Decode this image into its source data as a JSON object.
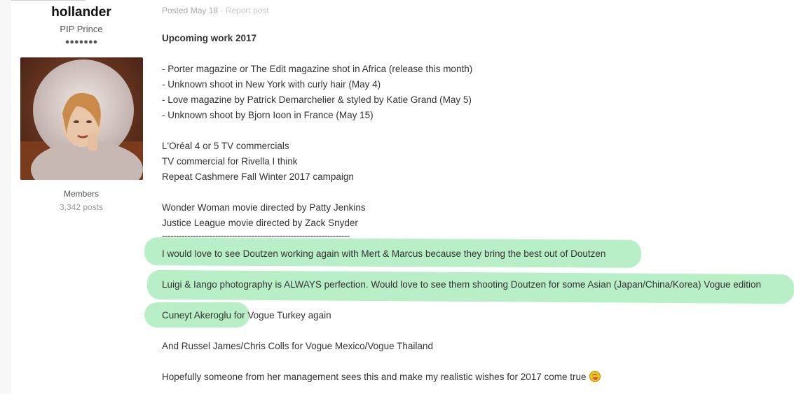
{
  "author": {
    "username": "hollander",
    "rank": "PIP Prince",
    "rank_pips": "●●●●●●●",
    "group": "Members",
    "post_count": "3,342 posts"
  },
  "post": {
    "posted": "Posted May 18",
    "separator": " · ",
    "report": "Report post",
    "title": "Upcoming work 2017",
    "lines": [
      "- Porter magazine or The Edit magazine shot in Africa (release this month)",
      "- Unknown shoot in New York with curly hair (May 4)",
      "- Love magazine by Patrick Demarchelier & styled by Katie Grand (May 5)",
      "- Unknown shoot by Bjorn Ioon in France (May 15)",
      "L'Oréal 4 or 5 TV commercials",
      "TV commercial for Rivella I think",
      "Repeat Cashmere Fall Winter 2017 campaign",
      "Wonder Woman movie directed by Patty Jenkins",
      "Justice League movie directed by Zack Snyder",
      "-------------------------------------------------------------------",
      "I would love to see Doutzen working again with Mert & Marcus because they bring the best out of Doutzen",
      "Luigi & Iango photography is ALWAYS perfection. Would love to see them shooting Doutzen for some Asian (Japan/China/Korea) Vogue edition",
      "Cuneyt Akeroglu for Vogue Turkey again",
      "And Russel James/Chris Colls for Vogue Mexico/Vogue Thailand",
      "Hopefully someone from her management sees this and make my realistic wishes for 2017 come true"
    ],
    "emoji": "tongue-out-smiley-icon"
  },
  "colors": {
    "highlight": "#b9efc6",
    "meta_text": "#aaaaaa"
  }
}
